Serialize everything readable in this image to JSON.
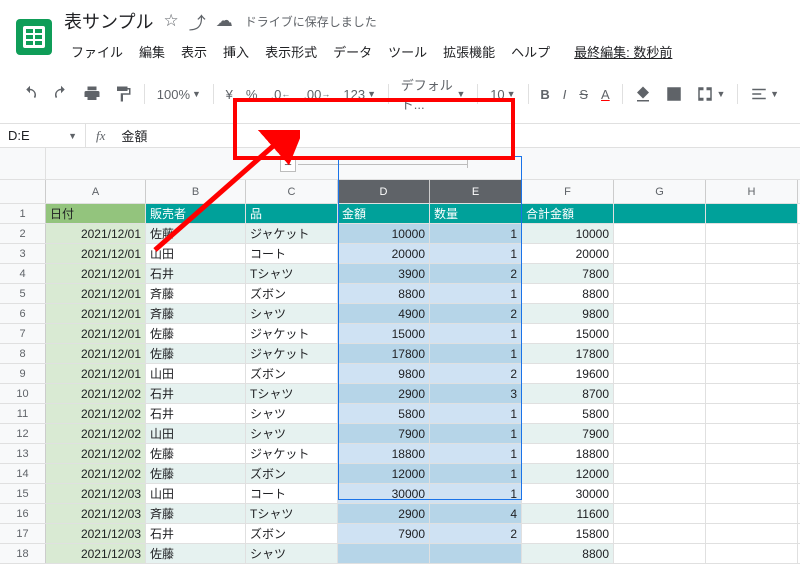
{
  "doc": {
    "title": "表サンプル",
    "cloud_status": "ドライブに保存しました"
  },
  "menus": [
    "ファイル",
    "編集",
    "表示",
    "挿入",
    "表示形式",
    "データ",
    "ツール",
    "拡張機能",
    "ヘルプ"
  ],
  "last_edit": "最終編集: 数秒前",
  "toolbar": {
    "zoom": "100%",
    "currency": "¥",
    "percent": "%",
    "dec_dec": ".0",
    "inc_dec": ".00",
    "more_fmt": "123",
    "font": "デフォルト...",
    "size": "10"
  },
  "name_box": "D:E",
  "fx_value": "金額",
  "columns": [
    "A",
    "B",
    "C",
    "D",
    "E",
    "F",
    "G",
    "H"
  ],
  "selected_cols": [
    "D",
    "E"
  ],
  "headers": {
    "A": "日付",
    "B": "販売者",
    "C": "品",
    "D": "金額",
    "E": "数量",
    "F": "合計金額"
  },
  "rows": [
    {
      "n": 2,
      "A": "2021/12/01",
      "B": "佐藤",
      "C": "ジャケット",
      "D": 10000,
      "E": 1,
      "F": 10000
    },
    {
      "n": 3,
      "A": "2021/12/01",
      "B": "山田",
      "C": "コート",
      "D": 20000,
      "E": 1,
      "F": 20000
    },
    {
      "n": 4,
      "A": "2021/12/01",
      "B": "石井",
      "C": "Tシャツ",
      "D": 3900,
      "E": 2,
      "F": 7800
    },
    {
      "n": 5,
      "A": "2021/12/01",
      "B": "斉藤",
      "C": "ズボン",
      "D": 8800,
      "E": 1,
      "F": 8800
    },
    {
      "n": 6,
      "A": "2021/12/01",
      "B": "斉藤",
      "C": "シャツ",
      "D": 4900,
      "E": 2,
      "F": 9800
    },
    {
      "n": 7,
      "A": "2021/12/01",
      "B": "佐藤",
      "C": "ジャケット",
      "D": 15000,
      "E": 1,
      "F": 15000
    },
    {
      "n": 8,
      "A": "2021/12/01",
      "B": "佐藤",
      "C": "ジャケット",
      "D": 17800,
      "E": 1,
      "F": 17800
    },
    {
      "n": 9,
      "A": "2021/12/01",
      "B": "山田",
      "C": "ズボン",
      "D": 9800,
      "E": 2,
      "F": 19600
    },
    {
      "n": 10,
      "A": "2021/12/02",
      "B": "石井",
      "C": "Tシャツ",
      "D": 2900,
      "E": 3,
      "F": 8700
    },
    {
      "n": 11,
      "A": "2021/12/02",
      "B": "石井",
      "C": "シャツ",
      "D": 5800,
      "E": 1,
      "F": 5800
    },
    {
      "n": 12,
      "A": "2021/12/02",
      "B": "山田",
      "C": "シャツ",
      "D": 7900,
      "E": 1,
      "F": 7900
    },
    {
      "n": 13,
      "A": "2021/12/02",
      "B": "佐藤",
      "C": "ジャケット",
      "D": 18800,
      "E": 1,
      "F": 18800
    },
    {
      "n": 14,
      "A": "2021/12/02",
      "B": "佐藤",
      "C": "ズボン",
      "D": 12000,
      "E": 1,
      "F": 12000
    },
    {
      "n": 15,
      "A": "2021/12/03",
      "B": "山田",
      "C": "コート",
      "D": 30000,
      "E": 1,
      "F": 30000
    },
    {
      "n": 16,
      "A": "2021/12/03",
      "B": "斉藤",
      "C": "Tシャツ",
      "D": 2900,
      "E": 4,
      "F": 11600
    },
    {
      "n": 17,
      "A": "2021/12/03",
      "B": "石井",
      "C": "ズボン",
      "D": 7900,
      "E": 2,
      "F": 15800
    },
    {
      "n": 18,
      "A": "2021/12/03",
      "B": "佐藤",
      "C": "シャツ",
      "D": "",
      "E": "",
      "F": 8800
    }
  ]
}
